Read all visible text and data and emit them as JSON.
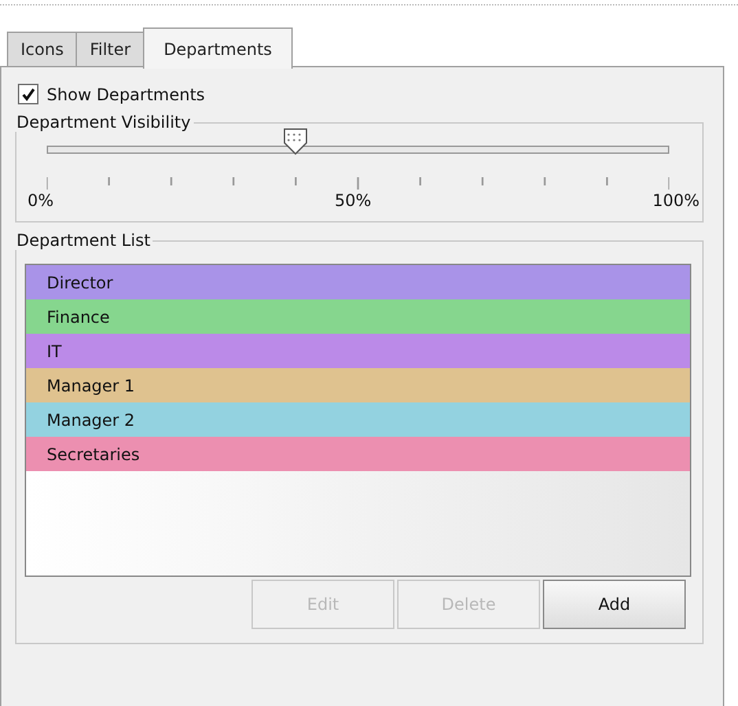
{
  "tabs": [
    {
      "label": "Icons",
      "selected": false
    },
    {
      "label": "Filter",
      "selected": false
    },
    {
      "label": "Departments",
      "selected": true
    }
  ],
  "show_departments": {
    "label": "Show Departments",
    "checked": true
  },
  "visibility": {
    "title": "Department Visibility",
    "level": 0.4,
    "tick_labels": [
      "0%",
      "50%",
      "100%"
    ]
  },
  "department_list": {
    "title": "Department List",
    "items": [
      {
        "name": "Director",
        "color": "#a993e8"
      },
      {
        "name": "Finance",
        "color": "#86d68e"
      },
      {
        "name": "IT",
        "color": "#bb8ae8"
      },
      {
        "name": "Manager 1",
        "color": "#dfc28f"
      },
      {
        "name": "Manager 2",
        "color": "#93d2e0"
      },
      {
        "name": "Secretaries",
        "color": "#ec8fb0"
      }
    ]
  },
  "buttons": [
    {
      "label": "Edit",
      "disabled": true
    },
    {
      "label": "Delete",
      "disabled": true
    },
    {
      "label": "Add",
      "disabled": false
    }
  ]
}
